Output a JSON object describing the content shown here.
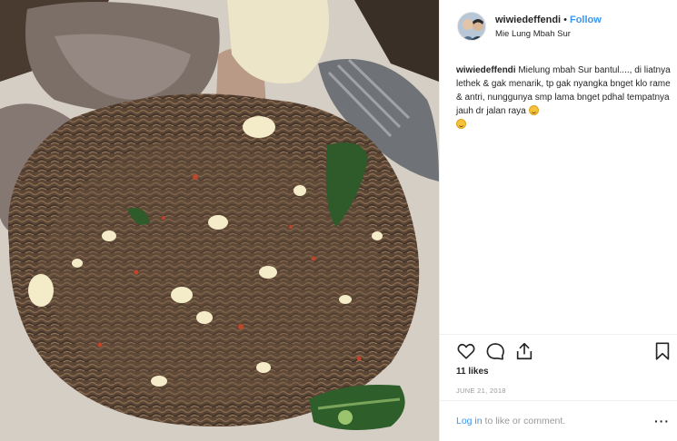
{
  "post": {
    "username": "wiwiedeffendi",
    "separator": "•",
    "follow_label": "Follow",
    "location": "Mie Lung Mbah Sur",
    "caption_text": "Mielung mbah Sur bantul...., di liatnya lethek & gak menarik, tp gak nyangka bnget klo rame & antri, nunggunya smp lama bnget pdhal tempatnya jauh dr jalan raya",
    "likes": "11 likes",
    "date": "JUNE 21, 2018",
    "login_link": "Log in",
    "login_rest": " to like or comment.",
    "more_label": "···"
  },
  "icons": {
    "like": "heart-icon",
    "comment": "comment-icon",
    "share": "share-icon",
    "save": "bookmark-icon"
  },
  "colors": {
    "link_blue": "#3897f0",
    "text": "#262626",
    "muted": "#999999",
    "divider": "#efefef"
  }
}
